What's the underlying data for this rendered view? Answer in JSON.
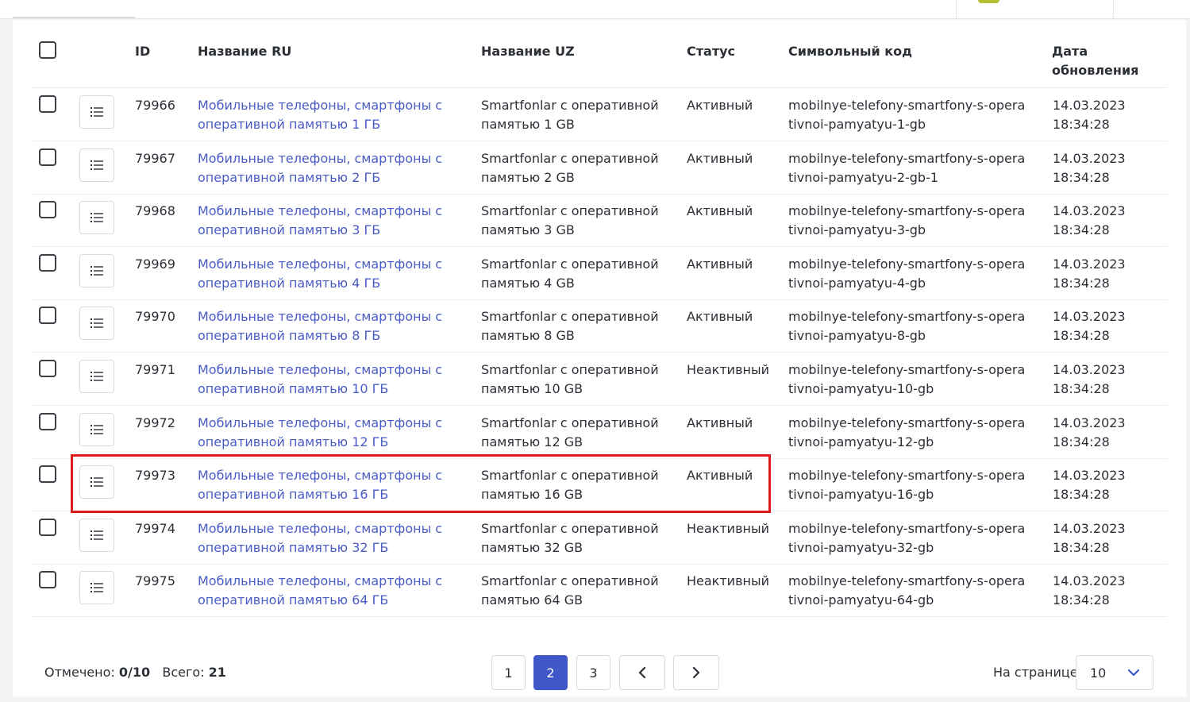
{
  "table": {
    "headers": {
      "id": "ID",
      "name_ru": "Название RU",
      "name_uz": "Название UZ",
      "status": "Статус",
      "code": "Символьный код",
      "date_line1": "Дата",
      "date_line2": "обновления"
    },
    "rows": [
      {
        "id": "79966",
        "name_ru": "Мобильные телефоны, смартфоны с оперативной памятью 1 ГБ",
        "name_uz": "Smartfonlar с оперативной памятью 1 GB",
        "status": "Активный",
        "code": "mobilnye-telefony-smartfony-s-operativnoi-pamyatyu-1-gb",
        "date": "14.03.2023",
        "time": "18:34:28"
      },
      {
        "id": "79967",
        "name_ru": "Мобильные телефоны, смартфоны с оперативной памятью 2 ГБ",
        "name_uz": "Smartfonlar с оперативной памятью 2 GB",
        "status": "Активный",
        "code": "mobilnye-telefony-smartfony-s-operativnoi-pamyatyu-2-gb-1",
        "date": "14.03.2023",
        "time": "18:34:28"
      },
      {
        "id": "79968",
        "name_ru": "Мобильные телефоны, смартфоны с оперативной памятью 3 ГБ",
        "name_uz": "Smartfonlar с оперативной памятью 3 GB",
        "status": "Активный",
        "code": "mobilnye-telefony-smartfony-s-operativnoi-pamyatyu-3-gb",
        "date": "14.03.2023",
        "time": "18:34:28"
      },
      {
        "id": "79969",
        "name_ru": "Мобильные телефоны, смартфоны с оперативной памятью 4 ГБ",
        "name_uz": "Smartfonlar с оперативной памятью 4 GB",
        "status": "Активный",
        "code": "mobilnye-telefony-smartfony-s-operativnoi-pamyatyu-4-gb",
        "date": "14.03.2023",
        "time": "18:34:28"
      },
      {
        "id": "79970",
        "name_ru": "Мобильные телефоны, смартфоны с оперативной памятью 8 ГБ",
        "name_uz": "Smartfonlar с оперативной памятью 8 GB",
        "status": "Активный",
        "code": "mobilnye-telefony-smartfony-s-operativnoi-pamyatyu-8-gb",
        "date": "14.03.2023",
        "time": "18:34:28"
      },
      {
        "id": "79971",
        "name_ru": "Мобильные телефоны, смартфоны с оперативной памятью 10 ГБ",
        "name_uz": "Smartfonlar с оперативной памятью 10 GB",
        "status": "Неактивный",
        "code": "mobilnye-telefony-smartfony-s-operativnoi-pamyatyu-10-gb",
        "date": "14.03.2023",
        "time": "18:34:28"
      },
      {
        "id": "79972",
        "name_ru": "Мобильные телефоны, смартфоны с оперативной памятью 12 ГБ",
        "name_uz": "Smartfonlar с оперативной памятью 12 GB",
        "status": "Активный",
        "code": "mobilnye-telefony-smartfony-s-operativnoi-pamyatyu-12-gb",
        "date": "14.03.2023",
        "time": "18:34:28"
      },
      {
        "id": "79973",
        "name_ru": "Мобильные телефоны, смартфоны с оперативной памятью 16 ГБ",
        "name_uz": "Smartfonlar с оперативной памятью 16 GB",
        "status": "Активный",
        "code": "mobilnye-telefony-smartfony-s-operativnoi-pamyatyu-16-gb",
        "date": "14.03.2023",
        "time": "18:34:28"
      },
      {
        "id": "79974",
        "name_ru": "Мобильные телефоны, смартфоны с оперативной памятью 32 ГБ",
        "name_uz": "Smartfonlar с оперативной памятью 32 GB",
        "status": "Неактивный",
        "code": "mobilnye-telefony-smartfony-s-operativnoi-pamyatyu-32-gb",
        "date": "14.03.2023",
        "time": "18:34:28"
      },
      {
        "id": "79975",
        "name_ru": "Мобильные телефоны, смартфоны с оперативной памятью 64 ГБ",
        "name_uz": "Smartfonlar с оперативной памятью 64 GB",
        "status": "Неактивный",
        "code": "mobilnye-telefony-smartfony-s-operativnoi-pamyatyu-64-gb",
        "date": "14.03.2023",
        "time": "18:34:28"
      }
    ]
  },
  "footer": {
    "selected_label": "Отмечено:",
    "selected_value": "0/10",
    "total_label": "Всего:",
    "total_value": "21",
    "pages": [
      "1",
      "2",
      "3"
    ],
    "current_page": "2",
    "per_page_label": "На странице",
    "per_page_value": "10"
  },
  "colors": {
    "link": "#4a5cc5",
    "accent": "#3e57c9",
    "highlight": "#e01b1b"
  },
  "icons": {
    "row_action": "list-icon",
    "prev": "chevron-left-icon",
    "next": "chevron-right-icon",
    "select": "chevron-down-icon"
  }
}
